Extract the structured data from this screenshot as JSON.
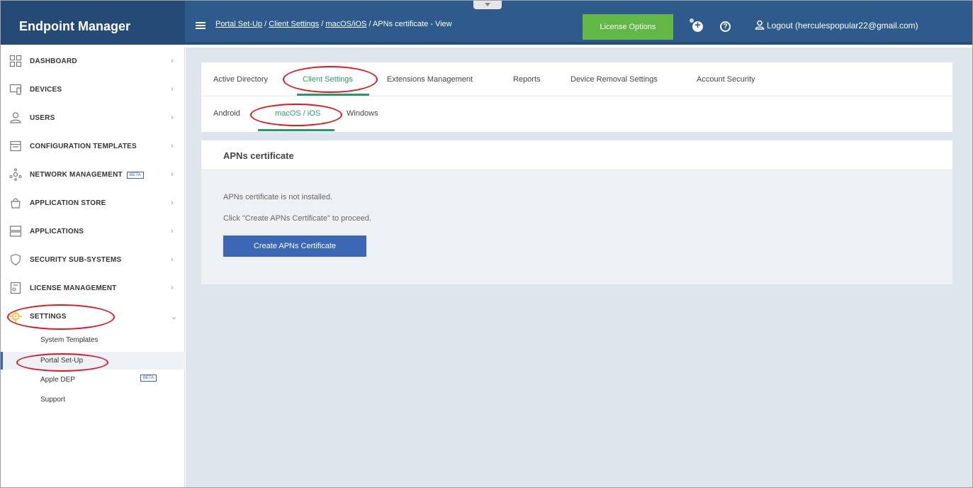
{
  "app": {
    "title": "Endpoint Manager"
  },
  "breadcrumb": {
    "items": [
      "Portal Set-Up",
      "Client Settings",
      "macOS/iOS"
    ],
    "separator": " / ",
    "current": "APNs certificate - View"
  },
  "header": {
    "license_label": "License Options",
    "help_glyph": "?",
    "logout_label": "Logout (herculespopular22@gmail.com)"
  },
  "sidebar": {
    "items": [
      {
        "label": "DASHBOARD",
        "icon": "dashboard-icon"
      },
      {
        "label": "DEVICES",
        "icon": "devices-icon"
      },
      {
        "label": "USERS",
        "icon": "users-icon"
      },
      {
        "label": "CONFIGURATION TEMPLATES",
        "icon": "templates-icon"
      },
      {
        "label": "NETWORK MANAGEMENT",
        "icon": "network-icon",
        "badge": "BETA"
      },
      {
        "label": "APPLICATION STORE",
        "icon": "store-icon"
      },
      {
        "label": "APPLICATIONS",
        "icon": "applications-icon"
      },
      {
        "label": "SECURITY SUB-SYSTEMS",
        "icon": "shield-icon"
      },
      {
        "label": "LICENSE MANAGEMENT",
        "icon": "license-icon"
      },
      {
        "label": "SETTINGS",
        "icon": "gear-icon"
      }
    ],
    "settings_sub": [
      {
        "label": "System Templates"
      },
      {
        "label": "Portal Set-Up"
      },
      {
        "label": "Apple DEP",
        "badge": "BETA"
      },
      {
        "label": "Support"
      }
    ]
  },
  "tabs": [
    "Active Directory",
    "Client Settings",
    "Extensions Management",
    "Reports",
    "Device Removal Settings",
    "Account Security"
  ],
  "subtabs": [
    "Android",
    "macOS / iOS",
    "Windows"
  ],
  "panel": {
    "title": "APNs certificate",
    "message1": "APNs certificate is not installed.",
    "message2": "Click \"Create APNs Certificate\" to proceed.",
    "button_label": "Create APNs Certificate"
  },
  "colors": {
    "header": "#2e5a8c",
    "brand": "#264a76",
    "license_button": "#63b845",
    "active_tab": "#2a9a6c",
    "primary_button": "#3b67b4",
    "annotation": "#e0141e"
  }
}
